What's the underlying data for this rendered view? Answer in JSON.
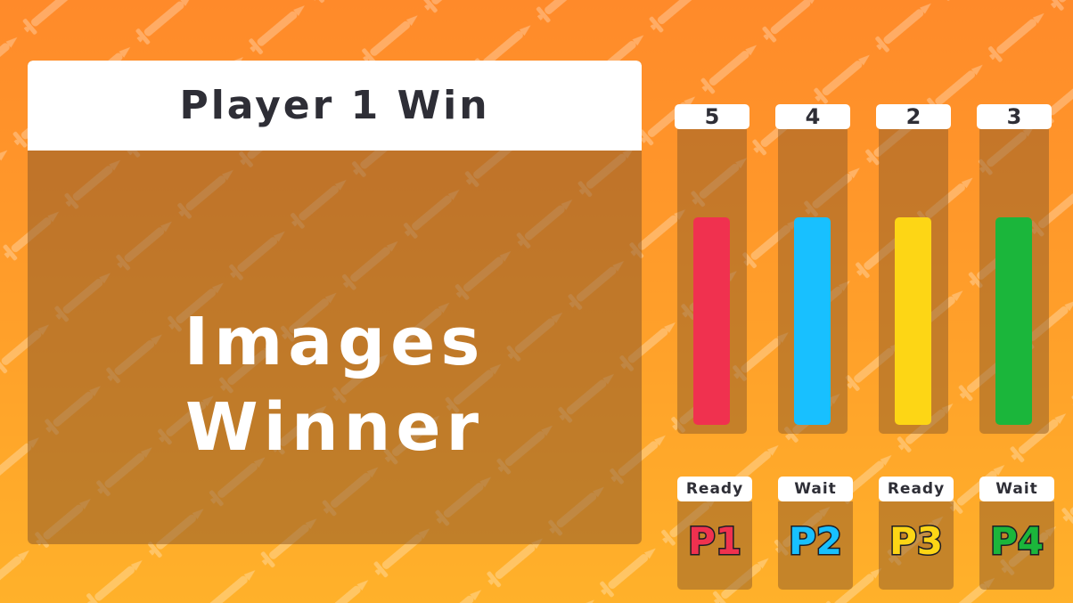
{
  "result": {
    "title": "Player 1 Win",
    "line1": "Images",
    "line2": "Winner"
  },
  "scores": [
    {
      "value": "5",
      "color": "#f0314f",
      "fill_level": 0.68
    },
    {
      "value": "4",
      "color": "#18c0ff",
      "fill_level": 0.68
    },
    {
      "value": "2",
      "color": "#fdd615",
      "fill_level": 0.68
    },
    {
      "value": "3",
      "color": "#1bb63b",
      "fill_level": 0.68
    }
  ],
  "players": [
    {
      "name": "P1",
      "status": "Ready",
      "color": "#f0314f"
    },
    {
      "name": "P2",
      "status": "Wait",
      "color": "#18c0ff"
    },
    {
      "name": "P3",
      "status": "Ready",
      "color": "#fdd615"
    },
    {
      "name": "P4",
      "status": "Wait",
      "color": "#1bb63b"
    }
  ],
  "icons": {
    "background_pattern": "sword-icon"
  }
}
